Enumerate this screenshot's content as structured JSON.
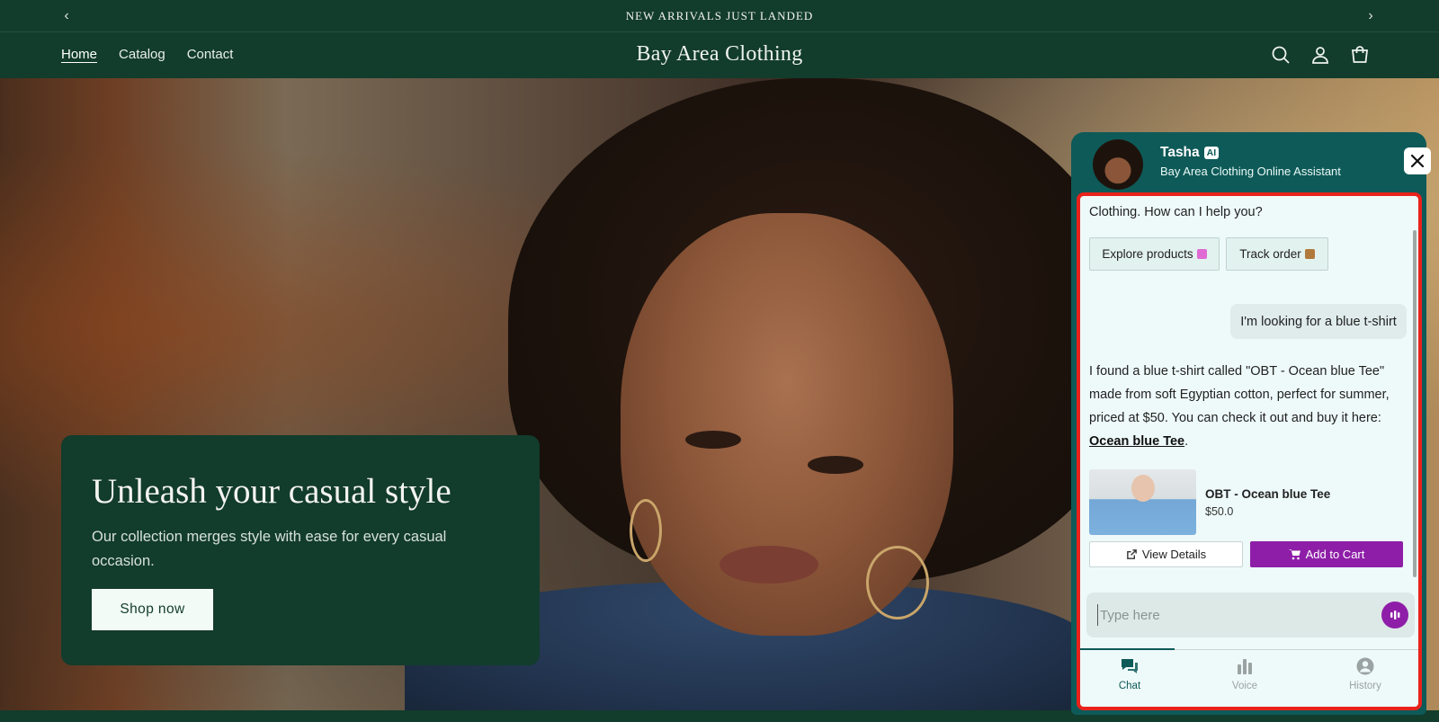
{
  "announcement": {
    "text": "NEW ARRIVALS JUST LANDED",
    "prev_icon": "chevron-left-icon",
    "next_icon": "chevron-right-icon"
  },
  "header": {
    "nav": [
      {
        "label": "Home",
        "active": true
      },
      {
        "label": "Catalog",
        "active": false
      },
      {
        "label": "Contact",
        "active": false
      }
    ],
    "brand": "Bay Area Clothing",
    "icons": [
      "search-icon",
      "account-icon",
      "cart-icon"
    ]
  },
  "hero": {
    "title": "Unleash your casual style",
    "subtitle": "Our collection merges style with ease for every casual occasion.",
    "cta": "Shop now"
  },
  "chat": {
    "agent_name": "Tasha",
    "agent_badge": "AI",
    "agent_role": "Bay Area Clothing Online Assistant",
    "intro": "Clothing. How can I help you?",
    "quick_replies": [
      "Explore products",
      "Track order"
    ],
    "user_message": "I'm looking for a blue t-shirt",
    "bot_message": "I found a blue t-shirt called \"OBT - Ocean blue Tee\" made from soft Egyptian cotton, perfect for summer, priced at $50. You can check it out and buy it here:",
    "bot_link": "Ocean blue Tee",
    "bot_after_link": ".",
    "product": {
      "name": "OBT - Ocean blue Tee",
      "price": "$50.0",
      "view_details": "View Details",
      "add_to_cart": "Add to Cart"
    },
    "input_placeholder": "Type here",
    "tabs": [
      {
        "label": "Chat",
        "icon": "chat-icon",
        "active": true
      },
      {
        "label": "Voice",
        "icon": "voice-bars-icon",
        "active": false
      },
      {
        "label": "History",
        "icon": "history-user-icon",
        "active": false
      }
    ]
  },
  "colors": {
    "brand_green": "#123c2c",
    "widget_teal": "#0e5a58",
    "accent_purple": "#8e1ea8",
    "highlight_red": "#e8221b"
  }
}
